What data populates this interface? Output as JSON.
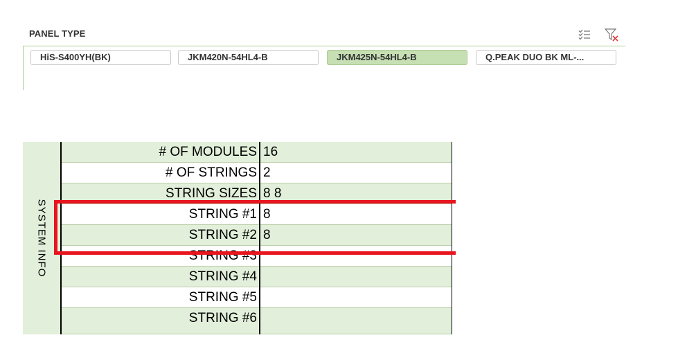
{
  "slicer": {
    "title": "PANEL TYPE",
    "icons": {
      "multi_select": "multi-select-icon",
      "clear_filter": "clear-filter-icon"
    },
    "items": [
      {
        "label": "HiS-S400YH(BK)",
        "selected": false
      },
      {
        "label": "JKM420N-54HL4-B",
        "selected": false
      },
      {
        "label": "JKM425N-54HL4-B",
        "selected": true
      },
      {
        "label": "Q.PEAK DUO BK ML-...",
        "selected": false
      }
    ]
  },
  "system_info": {
    "section_label": "SYSTEM INFO",
    "rows": [
      {
        "label": "# OF MODULES",
        "value": "16"
      },
      {
        "label": "# OF STRINGS",
        "value": "2"
      },
      {
        "label": "STRING SIZES",
        "value": "8 8"
      },
      {
        "label": "STRING #1",
        "value": "8"
      },
      {
        "label": "STRING #2",
        "value": "8"
      },
      {
        "label": "STRING #3",
        "value": ""
      },
      {
        "label": "STRING #4",
        "value": ""
      },
      {
        "label": "STRING #5",
        "value": ""
      },
      {
        "label": "STRING #6",
        "value": ""
      }
    ]
  },
  "colors": {
    "accent_green": "#a9d08e",
    "selected_fill": "#c6e0b4",
    "row_green": "#e2efda",
    "highlight_red": "#e8141e"
  }
}
